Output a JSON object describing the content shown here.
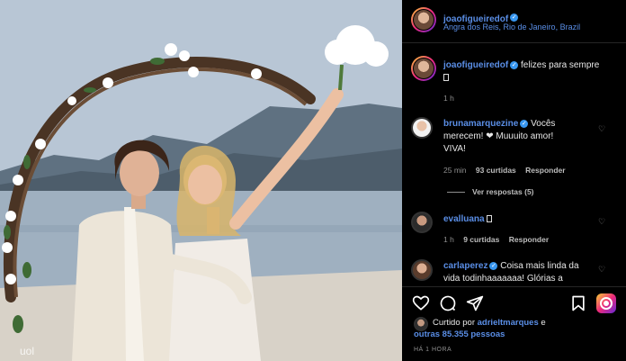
{
  "post": {
    "username": "joaofigueiredof",
    "location": "Angra dos Reis, Rio de Janeiro, Brazil",
    "caption_user": "joaofigueiredof",
    "caption_text": "felizes para sempre",
    "caption_time": "1 h"
  },
  "comments": [
    {
      "username": "brunamarquezine",
      "text_line1": "Vocês",
      "text_line2": "merecem! ❤ Muuuito amor!",
      "text_line3": "VIVA!",
      "time": "25 min",
      "likes": "93 curtidas",
      "reply": "Responder",
      "view_replies": "Ver respostas (5)"
    },
    {
      "username": "evalluana",
      "time": "1 h",
      "likes": "9 curtidas",
      "reply": "Responder"
    },
    {
      "username": "carlaperez",
      "text_line1": "Coisa mais linda da",
      "text_line2": "vida todinhaaaaaaa! Glórias a"
    }
  ],
  "likes": {
    "prefix": "Curtido por",
    "user": "adrieltmarques",
    "joiner": "e",
    "others": "outras 85.355 pessoas"
  },
  "timestamp": "HÁ 1 HORA",
  "photo": {
    "watermark": "uol"
  }
}
